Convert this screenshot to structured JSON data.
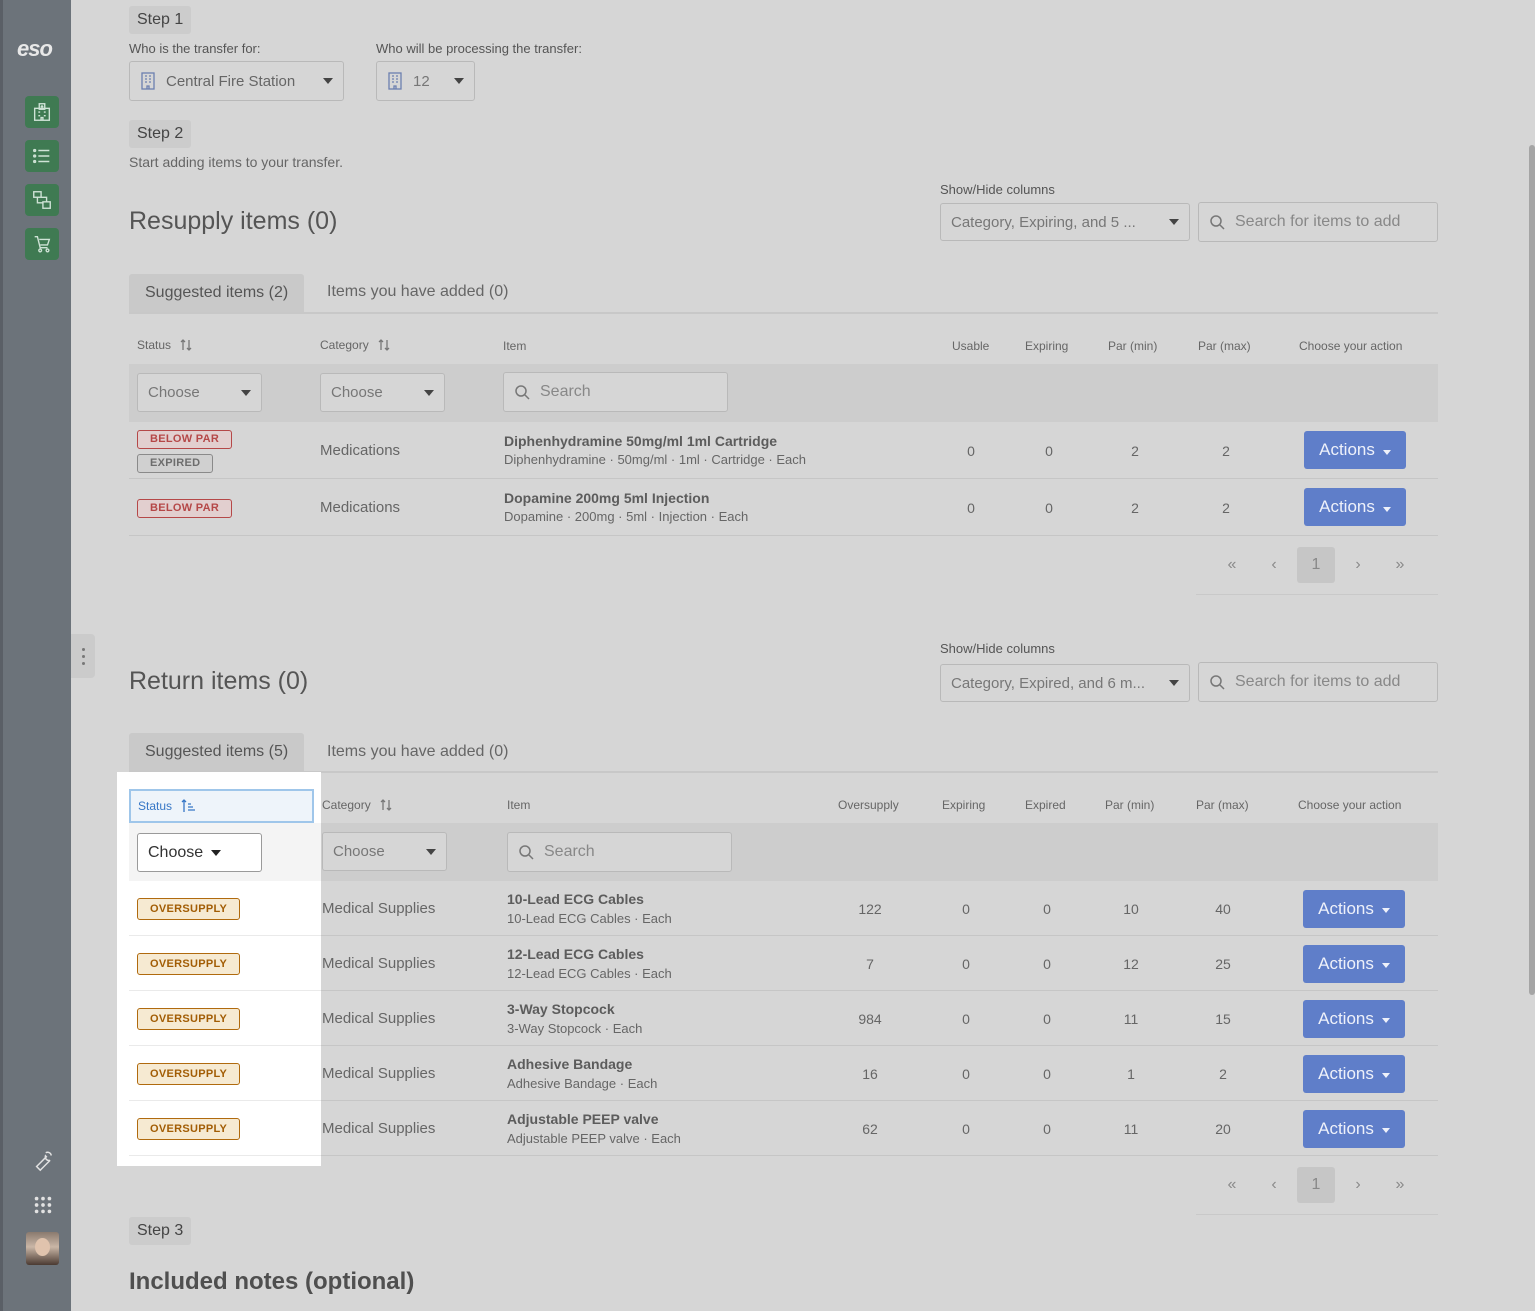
{
  "sidebar": {
    "logo": "eso",
    "nav": [
      {
        "icon": "hospital-grid-icon"
      },
      {
        "icon": "list-icon"
      },
      {
        "icon": "transfer-icon"
      },
      {
        "icon": "cart-icon"
      }
    ],
    "bottom": [
      {
        "icon": "wrench-icon"
      },
      {
        "icon": "apps-grid-icon"
      },
      {
        "icon": "user-avatar"
      }
    ]
  },
  "step1": {
    "label": "Step 1",
    "for_label": "Who is the transfer for:",
    "for_value": "Central Fire Station",
    "processing_label": "Who will be processing the transfer:",
    "processing_value": "12"
  },
  "step2": {
    "label": "Step 2",
    "helper": "Start adding items to your transfer."
  },
  "resupply": {
    "title": "Resupply items (0)",
    "columns_label": "Show/Hide columns",
    "columns_value": "Category, Expiring, and 5 ...",
    "search_placeholder": "Search for items to add",
    "tabs": [
      "Suggested items (2)",
      "Items you have added (0)"
    ],
    "headers": {
      "status": "Status",
      "category": "Category",
      "item": "Item",
      "usable": "Usable",
      "expiring": "Expiring",
      "par_min": "Par (min)",
      "par_max": "Par (max)",
      "action": "Choose your action"
    },
    "filter_choose": "Choose",
    "filter_search": "Search",
    "rows": [
      {
        "badges": [
          "BELOW PAR",
          "EXPIRED"
        ],
        "category": "Medications",
        "title": "Diphenhydramine 50mg/ml 1ml Cartridge",
        "sub": "Diphenhydramine · 50mg/ml · 1ml · Cartridge · Each",
        "usable": "0",
        "expiring": "0",
        "par_min": "2",
        "par_max": "2",
        "action": "Actions"
      },
      {
        "badges": [
          "BELOW PAR"
        ],
        "category": "Medications",
        "title": "Dopamine 200mg 5ml Injection",
        "sub": "Dopamine · 200mg · 5ml · Injection · Each",
        "usable": "0",
        "expiring": "0",
        "par_min": "2",
        "par_max": "2",
        "action": "Actions"
      }
    ],
    "pager": {
      "first": "«",
      "prev": "‹",
      "page": "1",
      "next": "›",
      "last": "»"
    }
  },
  "returns": {
    "title": "Return items (0)",
    "columns_label": "Show/Hide columns",
    "columns_value": "Category, Expired, and 6 m...",
    "search_placeholder": "Search for items to add",
    "tabs": [
      "Suggested items (5)",
      "Items you have added (0)"
    ],
    "headers": {
      "status": "Status",
      "category": "Category",
      "item": "Item",
      "oversupply": "Oversupply",
      "expiring": "Expiring",
      "expired": "Expired",
      "par_min": "Par (min)",
      "par_max": "Par (max)",
      "action": "Choose your action"
    },
    "filter_choose": "Choose",
    "filter_search": "Search",
    "rows": [
      {
        "badge": "OVERSUPPLY",
        "category": "Medical Supplies",
        "title": "10-Lead ECG Cables",
        "sub": "10-Lead ECG Cables · Each",
        "oversupply": "122",
        "expiring": "0",
        "expired": "0",
        "par_min": "10",
        "par_max": "40",
        "action": "Actions"
      },
      {
        "badge": "OVERSUPPLY",
        "category": "Medical Supplies",
        "title": "12-Lead ECG Cables",
        "sub": "12-Lead ECG Cables · Each",
        "oversupply": "7",
        "expiring": "0",
        "expired": "0",
        "par_min": "12",
        "par_max": "25",
        "action": "Actions"
      },
      {
        "badge": "OVERSUPPLY",
        "category": "Medical Supplies",
        "title": "3-Way Stopcock",
        "sub": "3-Way Stopcock · Each",
        "oversupply": "984",
        "expiring": "0",
        "expired": "0",
        "par_min": "11",
        "par_max": "15",
        "action": "Actions"
      },
      {
        "badge": "OVERSUPPLY",
        "category": "Medical Supplies",
        "title": "Adhesive Bandage",
        "sub": "Adhesive Bandage · Each",
        "oversupply": "16",
        "expiring": "0",
        "expired": "0",
        "par_min": "1",
        "par_max": "2",
        "action": "Actions"
      },
      {
        "badge": "OVERSUPPLY",
        "category": "Medical Supplies",
        "title": "Adjustable PEEP valve",
        "sub": "Adjustable PEEP valve · Each",
        "oversupply": "62",
        "expiring": "0",
        "expired": "0",
        "par_min": "11",
        "par_max": "20",
        "action": "Actions"
      }
    ],
    "pager": {
      "first": "«",
      "prev": "‹",
      "page": "1",
      "next": "›",
      "last": "»"
    }
  },
  "step3": {
    "label": "Step 3",
    "notes_title": "Included notes (optional)"
  },
  "colors": {
    "accent_green": "#3f7a52",
    "action_blue": "#5f7ec9",
    "below_par_red": "#b54848",
    "oversupply_orange": "#b06a0e",
    "sort_active_blue": "#3777c6"
  }
}
